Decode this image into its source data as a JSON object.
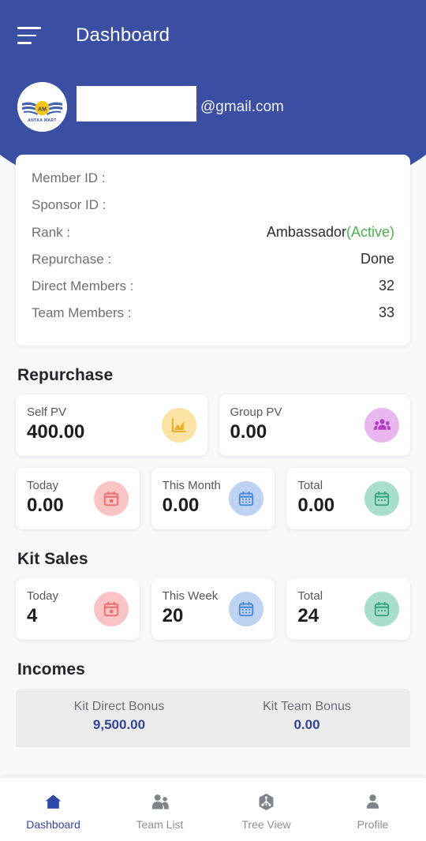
{
  "header": {
    "menu_icon": "hamburger-menu-icon",
    "title": "Dashboard",
    "avatar_icon": "antaa-mart-logo",
    "avatar_brand": "ANTAA MART",
    "avatar_monogram": "AM",
    "email": "@gmail.com",
    "email_redacted": true,
    "bg_color": "#3a4fa3"
  },
  "info_card": {
    "rows": [
      {
        "label": "Member ID :",
        "value": "",
        "style": "plain"
      },
      {
        "label": "Sponsor ID :",
        "value": "",
        "style": "faint"
      },
      {
        "label": "Rank :",
        "value": "Ambassador",
        "suffix": "(Active)",
        "style": "rank"
      },
      {
        "label": "Repurchase :",
        "value": "Done",
        "style": "plain"
      },
      {
        "label": "Direct Members :",
        "value": "32",
        "style": "plain"
      },
      {
        "label": "Team Members :",
        "value": "33",
        "style": "plain"
      }
    ],
    "active_color": "#4caf50"
  },
  "repurchase": {
    "title": "Repurchase",
    "row1": [
      {
        "label": "Self PV",
        "value": "400.00",
        "icon": "area-chart-icon",
        "icon_bg": "#fbe3a4",
        "icon_fg": "#e8a820"
      },
      {
        "label": "Group PV",
        "value": "0.00",
        "icon": "group-people-icon",
        "icon_bg": "#eab6f0",
        "icon_fg": "#b13fc4"
      }
    ],
    "row2": [
      {
        "label": "Today",
        "value": "0.00",
        "icon": "calendar-today-icon",
        "icon_bg": "#fbc4c4",
        "icon_fg": "#ef6a6a"
      },
      {
        "label": "This Month",
        "value": "0.00",
        "icon": "calendar-month-icon",
        "icon_bg": "#bed3f2",
        "icon_fg": "#4a86d6"
      },
      {
        "label": "Total",
        "value": "0.00",
        "icon": "calendar-total-icon",
        "icon_bg": "#a9ddcd",
        "icon_fg": "#35a383"
      }
    ]
  },
  "kit_sales": {
    "title": "Kit Sales",
    "cards": [
      {
        "label": "Today",
        "value": "4",
        "icon": "calendar-today-icon",
        "icon_bg": "#fbc4c4",
        "icon_fg": "#ef6a6a"
      },
      {
        "label": "This Week",
        "value": "20",
        "icon": "calendar-week-icon",
        "icon_bg": "#bed3f2",
        "icon_fg": "#4a86d6"
      },
      {
        "label": "Total",
        "value": "24",
        "icon": "calendar-total-icon",
        "icon_bg": "#a9ddcd",
        "icon_fg": "#35a383"
      }
    ]
  },
  "incomes": {
    "title": "Incomes",
    "items": [
      {
        "label": "Kit Direct Bonus",
        "value": "9,500.00"
      },
      {
        "label": "Kit Team Bonus",
        "value": "0.00"
      }
    ],
    "value_color": "#33449c"
  },
  "bottom_nav": {
    "active_color": "#2f46ab",
    "items": [
      {
        "label": "Dashboard",
        "icon": "home-icon",
        "active": true
      },
      {
        "label": "Team List",
        "icon": "people-icon",
        "active": false
      },
      {
        "label": "Tree View",
        "icon": "network-tree-icon",
        "active": false
      },
      {
        "label": "Profile",
        "icon": "person-icon",
        "active": false
      }
    ]
  }
}
